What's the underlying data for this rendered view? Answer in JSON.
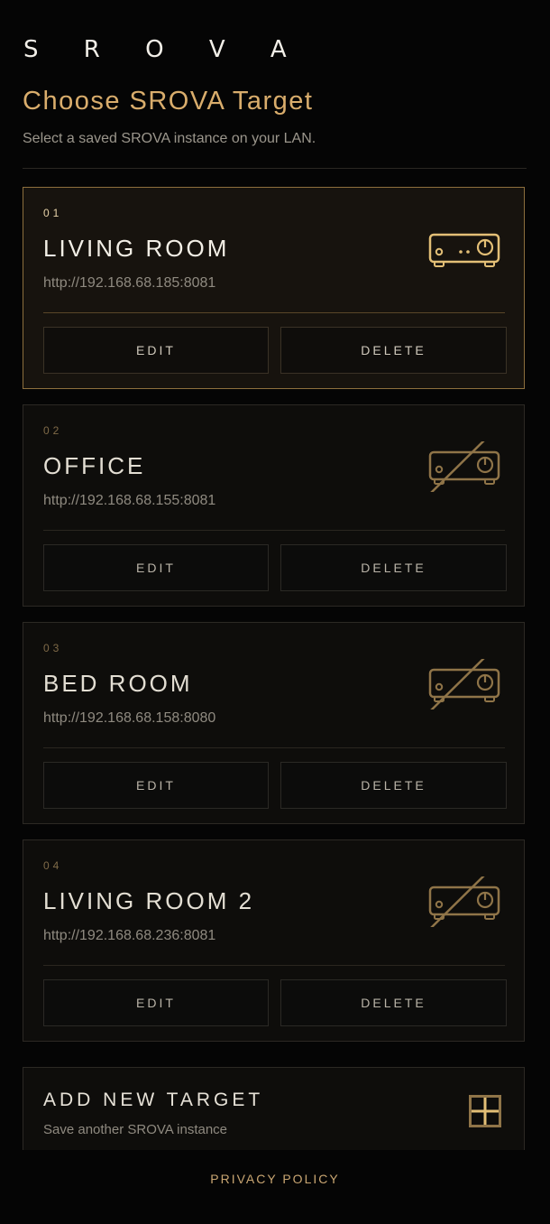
{
  "brand": "S R O V A",
  "header": {
    "title": "Choose SROVA Target",
    "subtitle": "Select a saved SROVA instance on your LAN."
  },
  "targets": [
    {
      "index": "01",
      "name": "LIVING ROOM",
      "url": "http://192.168.68.185:8081",
      "status": "online",
      "edit_label": "EDIT",
      "delete_label": "DELETE"
    },
    {
      "index": "02",
      "name": "OFFICE",
      "url": "http://192.168.68.155:8081",
      "status": "offline",
      "edit_label": "EDIT",
      "delete_label": "DELETE"
    },
    {
      "index": "03",
      "name": "BED ROOM",
      "url": "http://192.168.68.158:8080",
      "status": "offline",
      "edit_label": "EDIT",
      "delete_label": "DELETE"
    },
    {
      "index": "04",
      "name": "LIVING ROOM 2",
      "url": "http://192.168.68.236:8081",
      "status": "offline",
      "edit_label": "EDIT",
      "delete_label": "DELETE"
    }
  ],
  "add_target": {
    "title": "ADD NEW TARGET",
    "subtitle": "Save another SROVA instance",
    "icon": "plus-icon"
  },
  "footer": {
    "privacy_label": "PRIVACY POLICY"
  },
  "colors": {
    "accent": "#d9ad6c",
    "background": "#050505",
    "card": "#0e0d0b",
    "active_border": "#8d6f3d"
  }
}
